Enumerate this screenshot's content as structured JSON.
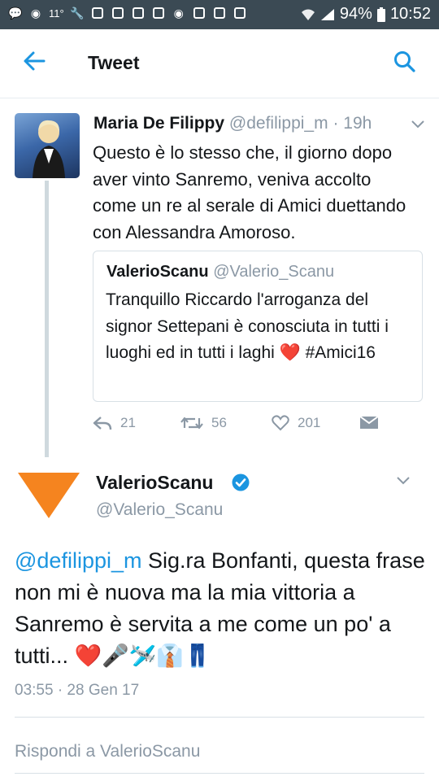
{
  "status_bar": {
    "temperature": "11°",
    "battery": "94%",
    "time": "10:52"
  },
  "header": {
    "title": "Tweet"
  },
  "parent_tweet": {
    "name": "Maria De Filippy",
    "handle": "@defilippi_m",
    "time": "· 19h",
    "text": "Questo è lo stesso che, il giorno dopo aver vinto Sanremo, veniva accolto come un re al serale di Amici duettando con Alessandra Amoroso.",
    "quoted": {
      "name": "ValerioScanu",
      "handle": "@Valerio_Scanu",
      "text": "Tranquillo Riccardo l'arroganza del signor Settepani è conosciuta in tutti i luoghi ed in tutti i laghi ❤️ #Amici16"
    },
    "actions": {
      "replies": "21",
      "retweets": "56",
      "likes": "201"
    }
  },
  "main_tweet": {
    "name": "ValerioScanu",
    "handle": "@Valerio_Scanu",
    "mention": "@defilippi_m",
    "text": "Sig.ra Bonfanti, questa frase non mi è nuova ma la mia vittoria a Sanremo è servita a me come un po' a tutti... ❤️🎤🛩️👔👖",
    "timestamp": "03:55 · 28 Gen 17"
  },
  "reply_box": {
    "placeholder": "Rispondi a ValerioScanu"
  },
  "colors": {
    "status_bar": "#3b4a54",
    "accent": "#1b95e0",
    "muted": "#8b98a5",
    "logo": "#f5841f"
  }
}
